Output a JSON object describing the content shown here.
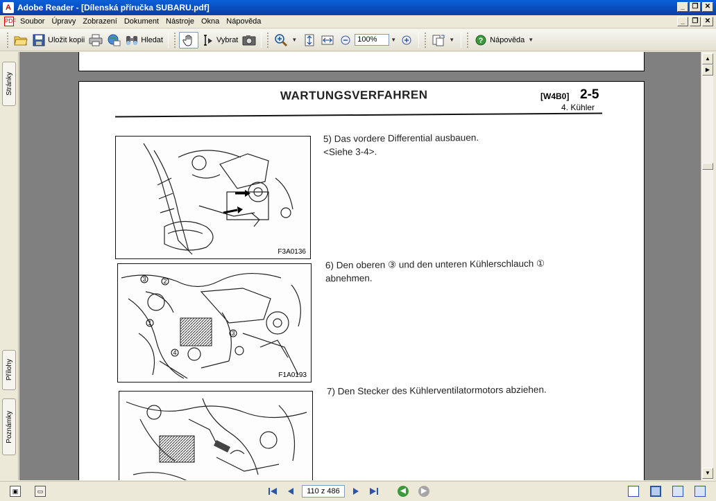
{
  "window": {
    "title": "Adobe Reader - [Dílenská příručka SUBARU.pdf]",
    "minimize": "_",
    "restore": "❐",
    "close": "✕"
  },
  "menu": {
    "items": [
      "Soubor",
      "Úpravy",
      "Zobrazení",
      "Dokument",
      "Nástroje",
      "Okna",
      "Nápověda"
    ]
  },
  "toolbar": {
    "save_copy": "Uložit kopii",
    "search": "Hledat",
    "select": "Vybrat",
    "zoom_value": "100%",
    "help": "Nápověda"
  },
  "left_tabs": {
    "pages": "Stránky",
    "attachments": "Přílohy",
    "comments": "Poznámky"
  },
  "page": {
    "title": "WARTUNGSVERFAHREN",
    "code": "[W4B0]",
    "number": "2-5",
    "subtitle": "4. Kühler",
    "figures": [
      {
        "label": "F3A0136"
      },
      {
        "label": "F1A0193"
      },
      {
        "label": ""
      }
    ],
    "steps": [
      {
        "line1": "5) Das vordere Differential ausbauen.",
        "line2": "<Siehe 3-4>."
      },
      {
        "line1": "6) Den oberen ③ und den unteren Kühlerschlauch ①",
        "line2": "abnehmen."
      },
      {
        "line1": "7) Den Stecker des Kühlerventilatormotors abziehen.",
        "line2": ""
      }
    ]
  },
  "statusbar": {
    "page_indicator": "110 z 486"
  }
}
